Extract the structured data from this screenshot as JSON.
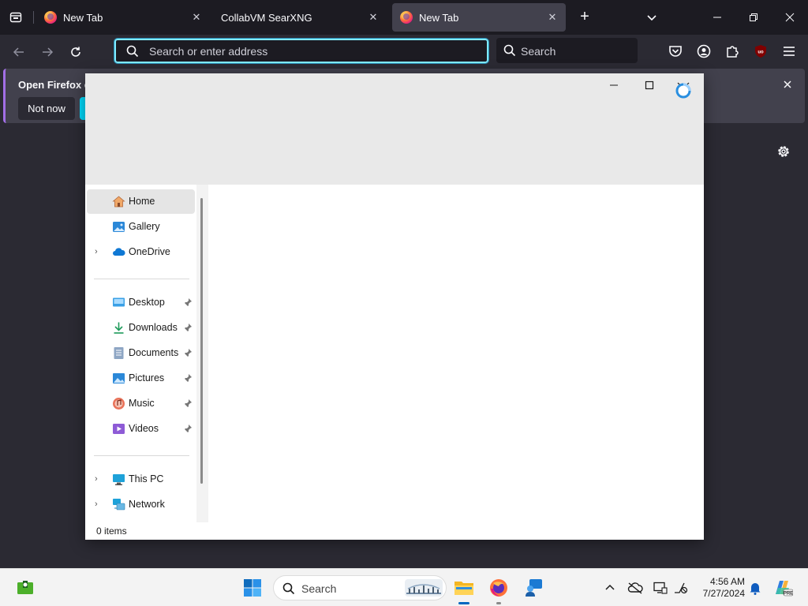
{
  "browser": {
    "tabs": [
      {
        "label": "New Tab",
        "active": false
      },
      {
        "label": "CollabVM SearXNG",
        "active": false
      },
      {
        "label": "New Tab",
        "active": true
      }
    ],
    "urlbar_placeholder": "Search or enter address",
    "searchbar_placeholder": "Search",
    "notification": {
      "title": "Open Firefox ev",
      "not_now_label": "Not now"
    },
    "accent_color": "#80ebff"
  },
  "explorer": {
    "nav": {
      "items": [
        {
          "label": "Home",
          "icon": "home-icon",
          "selected": true
        },
        {
          "label": "Gallery",
          "icon": "gallery-icon"
        },
        {
          "label": "OneDrive",
          "icon": "onedrive-icon",
          "expandable": true
        },
        {
          "label": "Desktop",
          "icon": "desktop-folder-icon",
          "pinned": true
        },
        {
          "label": "Downloads",
          "icon": "downloads-icon",
          "pinned": true
        },
        {
          "label": "Documents",
          "icon": "documents-icon",
          "pinned": true
        },
        {
          "label": "Pictures",
          "icon": "pictures-icon",
          "pinned": true
        },
        {
          "label": "Music",
          "icon": "music-icon",
          "pinned": true
        },
        {
          "label": "Videos",
          "icon": "videos-icon",
          "pinned": true
        },
        {
          "label": "This PC",
          "icon": "this-pc-icon",
          "expandable": true
        },
        {
          "label": "Network",
          "icon": "network-icon",
          "expandable": true
        }
      ]
    },
    "status": "0 items"
  },
  "taskbar": {
    "search_label": "Search",
    "time": "4:56 AM",
    "date": "7/27/2024",
    "apps": [
      "start-icon",
      "file-explorer-icon",
      "firefox-icon",
      "chat-app-icon",
      "copilot-icon"
    ]
  }
}
